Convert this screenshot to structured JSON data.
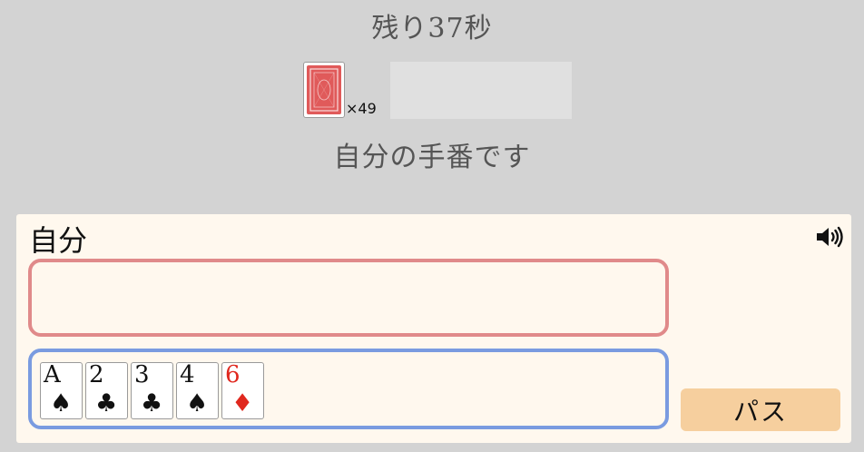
{
  "header": {
    "timer_text": "残り37秒",
    "status_text": "自分の手番です"
  },
  "deck": {
    "count_label": "×49",
    "back_color": "#e05a5a"
  },
  "player": {
    "name": "自分",
    "sound_icon": "speaker-volume-icon"
  },
  "hand": {
    "cards": [
      {
        "rank": "A",
        "suit": "♠",
        "color": "#111111"
      },
      {
        "rank": "2",
        "suit": "♣",
        "color": "#111111"
      },
      {
        "rank": "3",
        "suit": "♣",
        "color": "#111111"
      },
      {
        "rank": "4",
        "suit": "♠",
        "color": "#111111"
      },
      {
        "rank": "6",
        "suit": "♦",
        "color": "#e0281e"
      }
    ]
  },
  "actions": {
    "pass_label": "パス"
  },
  "colors": {
    "played_area_border": "#e08a8a",
    "hand_area_border": "#7a9be0",
    "pass_button_bg": "#f6cf9e"
  }
}
